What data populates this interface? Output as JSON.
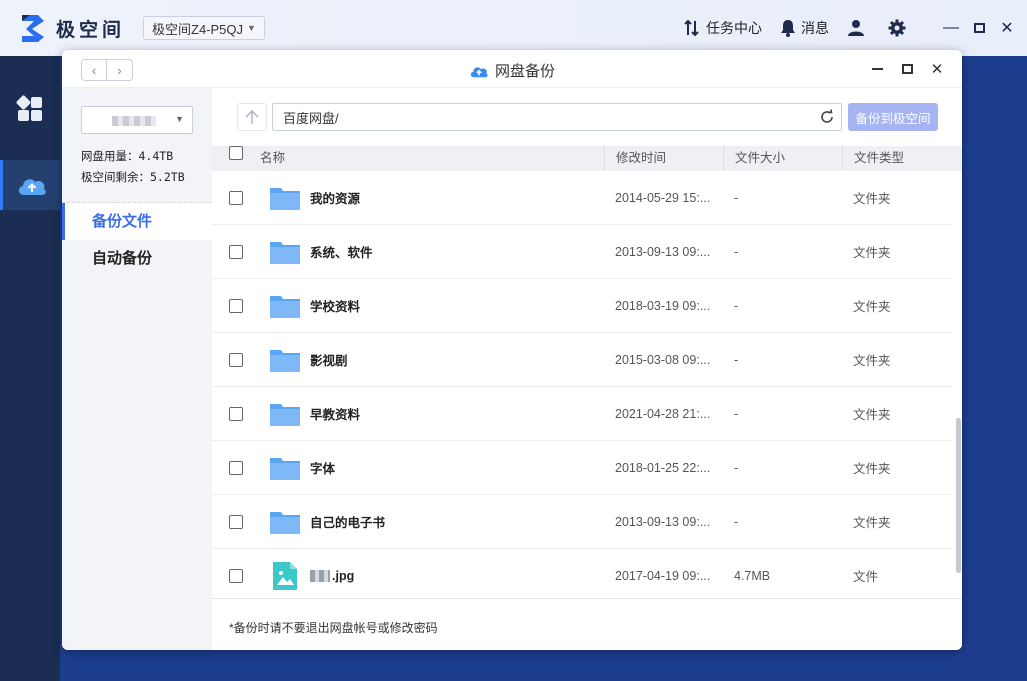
{
  "app": {
    "name": "极空间",
    "device": "极空间Z4-P5QJ"
  },
  "topbar": {
    "tasks_label": "任务中心",
    "messages_label": "消息"
  },
  "window": {
    "title": "网盘备份"
  },
  "sidebar": {
    "usage_label": "网盘用量：4.4TB",
    "remaining_label": "极空间剩余：5.2TB",
    "menu": [
      {
        "label": "备份文件",
        "active": true
      },
      {
        "label": "自动备份",
        "active": false
      }
    ]
  },
  "toolbar": {
    "path": "百度网盘/",
    "backup_button": "备份到极空间"
  },
  "table": {
    "headers": {
      "name": "名称",
      "modified": "修改时间",
      "size": "文件大小",
      "type": "文件类型"
    },
    "rows": [
      {
        "name": "我的资源",
        "modified": "2014-05-29 15:...",
        "size": "-",
        "type": "文件夹",
        "icon": "folder-icon"
      },
      {
        "name": "系统、软件",
        "modified": "2013-09-13 09:...",
        "size": "-",
        "type": "文件夹",
        "icon": "folder-icon"
      },
      {
        "name": "学校资料",
        "modified": "2018-03-19 09:...",
        "size": "-",
        "type": "文件夹",
        "icon": "folder-icon"
      },
      {
        "name": "影视剧",
        "modified": "2015-03-08 09:...",
        "size": "-",
        "type": "文件夹",
        "icon": "folder-icon"
      },
      {
        "name": "早教资料",
        "modified": "2021-04-28 21:...",
        "size": "-",
        "type": "文件夹",
        "icon": "folder-icon"
      },
      {
        "name": "字体",
        "modified": "2018-01-25 22:...",
        "size": "-",
        "type": "文件夹",
        "icon": "folder-icon"
      },
      {
        "name": "自己的电子书",
        "modified": "2013-09-13 09:...",
        "size": "-",
        "type": "文件夹",
        "icon": "folder-icon"
      },
      {
        "name": ".jpg",
        "modified": "2017-04-19 09:...",
        "size": "4.7MB",
        "type": "文件",
        "icon": "image-file-icon"
      }
    ]
  },
  "footer": {
    "note": "*备份时请不要退出网盘帐号或修改密码"
  },
  "colors": {
    "accent": "#3a6ee8",
    "folder": "#5aa6f5",
    "backup_button_bg": "#a6b4f4"
  }
}
